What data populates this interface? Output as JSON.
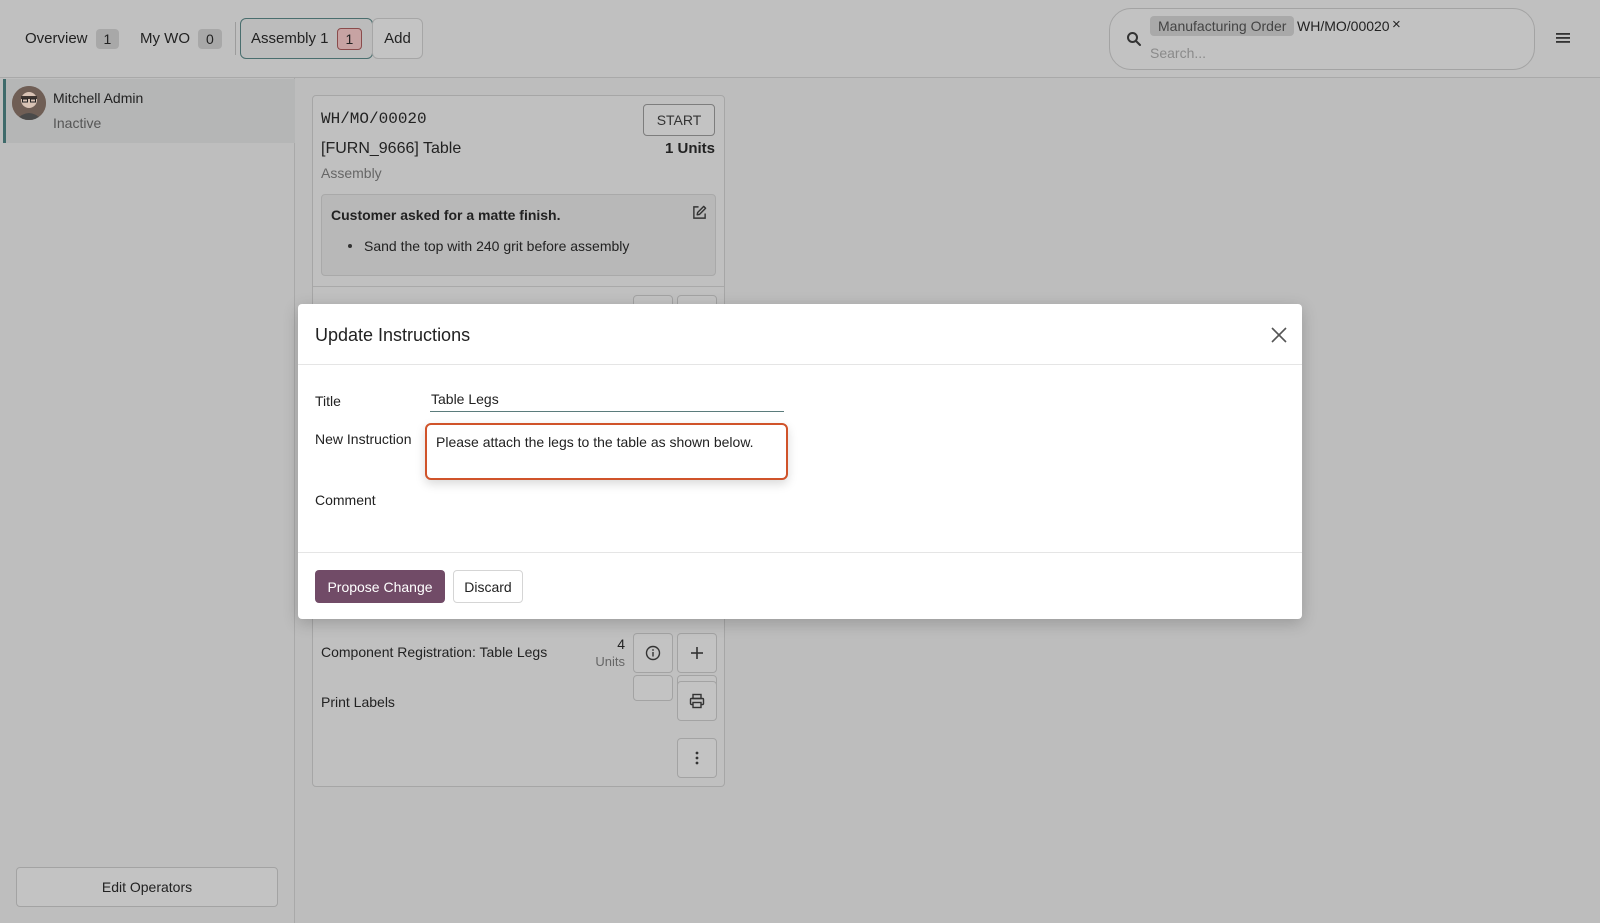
{
  "topbar": {
    "tabs": [
      {
        "label": "Overview",
        "count": "1"
      },
      {
        "label": "My WO",
        "count": "0"
      },
      {
        "label": "Assembly 1",
        "count": "1"
      }
    ],
    "add_label": "Add",
    "search": {
      "facet_label": "Manufacturing Order",
      "facet_value": "WH/MO/00020",
      "facet_remove": "×",
      "placeholder": "Search..."
    }
  },
  "sidebar": {
    "operator": {
      "name": "Mitchell Admin",
      "status": "Inactive"
    },
    "edit_operators_label": "Edit Operators"
  },
  "workorder": {
    "reference": "WH/MO/00020",
    "start_label": "START",
    "product": "[FURN_9666] Table",
    "quantity": "1 Units",
    "workcenter": "Assembly",
    "note": {
      "title": "Customer asked for a matte finish.",
      "items": [
        "Sand the top with 240 grit before assembly"
      ]
    },
    "component_row": {
      "label": "Component Registration: Table Legs",
      "qty": "4",
      "unit": "Units"
    },
    "print_labels": "Print Labels"
  },
  "modal": {
    "title": "Update Instructions",
    "title_label": "Title",
    "title_value": "Table Legs",
    "instruction_label": "New Instruction",
    "instruction_value": "Please attach the legs to the table as shown below.",
    "comment_label": "Comment",
    "propose_label": "Propose Change",
    "discard_label": "Discard"
  },
  "colors": {
    "primary": "#714b67",
    "focus_border": "#d0532a",
    "active_tab_border": "#4a6e6e"
  }
}
